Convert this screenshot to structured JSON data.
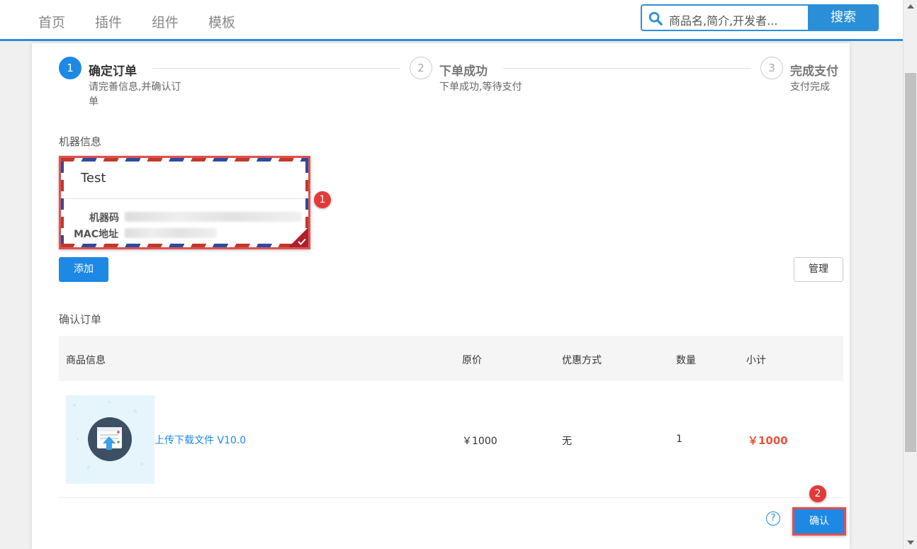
{
  "nav": {
    "items": [
      "首页",
      "插件",
      "组件",
      "模板"
    ],
    "search_placeholder": "商品名,简介,开发者...",
    "search_button": "搜索"
  },
  "steps": [
    {
      "number": "1",
      "title": "确定订单",
      "desc_line1": "请完善信息,并确认订",
      "desc_line2": "单",
      "active": true
    },
    {
      "number": "2",
      "title": "下单成功",
      "desc_line1": "下单成功,等待支付",
      "active": false
    },
    {
      "number": "3",
      "title": "完成支付",
      "desc_line1": "支付完成",
      "active": false
    }
  ],
  "machine_section": {
    "label": "机器信息",
    "card": {
      "name": "Test",
      "machine_code_label": "机器码",
      "mac_label": "MAC地址"
    },
    "add_button": "添加",
    "manage_button": "管理"
  },
  "order_section": {
    "label": "确认订单",
    "headers": [
      "商品信息",
      "原价",
      "优惠方式",
      "数量",
      "小计"
    ],
    "row": {
      "product_name": "上传下载文件 V10.0",
      "price": "￥1000",
      "discount": "无",
      "quantity": "1",
      "subtotal": "￥1000"
    },
    "help": "?",
    "confirm_button": "确认"
  },
  "annotations": [
    "1",
    "2"
  ],
  "colors": {
    "primary": "#1e88e5",
    "highlight": "#e05050",
    "price": "#e8553f"
  }
}
